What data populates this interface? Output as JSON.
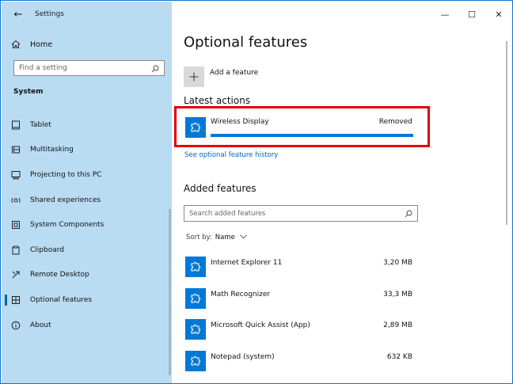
{
  "window": {
    "title": "Settings"
  },
  "controls": {
    "minimize": "—",
    "maximize": "☐",
    "close": "✕"
  },
  "sidebar": {
    "home_label": "Home",
    "search_placeholder": "Find a setting",
    "section_label": "System",
    "items": [
      {
        "label": "Tablet",
        "icon": "tablet-icon"
      },
      {
        "label": "Multitasking",
        "icon": "multitasking-icon"
      },
      {
        "label": "Projecting to this PC",
        "icon": "projecting-icon"
      },
      {
        "label": "Shared experiences",
        "icon": "shared-experiences-icon"
      },
      {
        "label": "System Components",
        "icon": "system-components-icon"
      },
      {
        "label": "Clipboard",
        "icon": "clipboard-icon"
      },
      {
        "label": "Remote Desktop",
        "icon": "remote-desktop-icon"
      },
      {
        "label": "Optional features",
        "icon": "optional-features-icon",
        "active": true
      },
      {
        "label": "About",
        "icon": "about-icon"
      }
    ]
  },
  "main": {
    "page_title": "Optional features",
    "add_feature_label": "Add a feature",
    "latest_actions_title": "Latest actions",
    "latest_item": {
      "name": "Wireless Display",
      "status": "Removed",
      "progress": 1.0
    },
    "history_link": "See optional feature history",
    "added_features_title": "Added features",
    "search_placeholder": "Search added features",
    "sort_label": "Sort by:",
    "sort_value": "Name",
    "features": [
      {
        "name": "Internet Explorer 11",
        "size": "3,20 MB"
      },
      {
        "name": "Math Recognizer",
        "size": "33,3 MB"
      },
      {
        "name": "Microsoft Quick Assist (App)",
        "size": "2,89 MB"
      },
      {
        "name": "Notepad (system)",
        "size": "632 KB"
      }
    ]
  },
  "colors": {
    "accent": "#0078d7",
    "sidebar_bg": "#b9dcf3",
    "highlight": "#e30000",
    "link": "#0066b4"
  }
}
